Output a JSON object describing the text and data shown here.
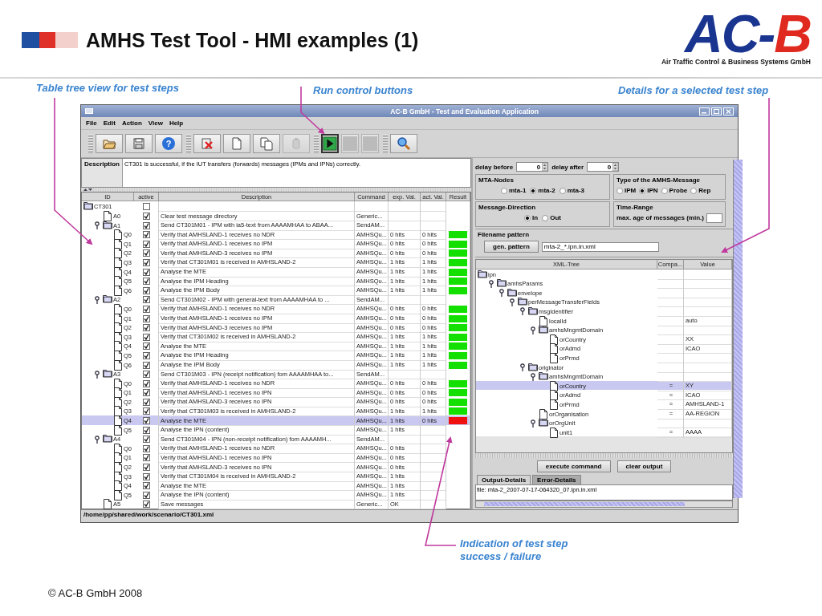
{
  "slide": {
    "title": "AMHS Test Tool - HMI examples (1)",
    "logo": {
      "text": "AC-",
      "accent": "B",
      "tagline": "Air Traffic Control & Business Systems GmbH"
    },
    "annotations": [
      {
        "text": "Table tree view for test steps"
      },
      {
        "text": "Run control buttons"
      },
      {
        "text": "Details for a selected test step"
      },
      {
        "text": "Indication of test step success / failure"
      }
    ],
    "footer": "© AC-B GmbH 2008"
  },
  "window": {
    "title": "AC-B GmbH - Test and Evaluation Application"
  },
  "menu": [
    "File",
    "Edit",
    "Action",
    "View",
    "Help"
  ],
  "toolbar": [
    {
      "buttons": [
        {
          "kind": "open",
          "disabled": false,
          "pressed": false
        },
        {
          "kind": "save",
          "disabled": false,
          "pressed": false
        },
        {
          "kind": "help",
          "glyph": "?",
          "disabled": false,
          "pressed": false
        }
      ]
    },
    {
      "buttons": [
        {
          "kind": "delete",
          "disabled": false,
          "pressed": false
        },
        {
          "kind": "new",
          "disabled": false,
          "pressed": false
        },
        {
          "kind": "copy",
          "disabled": false,
          "pressed": false
        },
        {
          "kind": "trash",
          "disabled": true,
          "pressed": false
        }
      ]
    },
    {
      "buttons": [
        {
          "kind": "play",
          "disabled": false,
          "pressed": true
        },
        {
          "kind": "pause",
          "disabled": true,
          "pressed": false
        },
        {
          "kind": "stop",
          "disabled": true,
          "pressed": false
        }
      ]
    },
    {
      "buttons": [
        {
          "kind": "search",
          "disabled": false,
          "pressed": false
        }
      ]
    }
  ],
  "description": {
    "label": "Description",
    "text": "CT301 is successful, if the IUT transfers (forwards) messages (IPMs and IPNs) correctly."
  },
  "test_table": {
    "columns": [
      "ID",
      "active",
      "Description",
      "Command",
      "exp. Val.",
      "act. Val.",
      "Result"
    ],
    "rows": [
      {
        "id": "CT301",
        "kind": "group",
        "active": false,
        "selected": false,
        "children": [
          {
            "id": "A0",
            "kind": "step",
            "active": true,
            "selected": false,
            "description": "Clear test message directory",
            "command": "Generic..."
          },
          {
            "id": "A1",
            "kind": "group",
            "expanded": true,
            "active": true,
            "selected": false,
            "description": "Send CT301M01 - IPM with ia5-text from AAAAMHAA to ABAA...",
            "command": "SendAM...",
            "children": [
              {
                "id": "Q0",
                "kind": "step",
                "active": true,
                "selected": false,
                "description": "Verify that AMHSLAND-1 receives no NDR",
                "command": "AMHSQu...",
                "expected": "0 hits",
                "actual": "0 hits",
                "passed": true
              },
              {
                "id": "Q1",
                "kind": "step",
                "active": true,
                "selected": false,
                "description": "Verify that AMHSLAND-1 receives no IPM",
                "command": "AMHSQu...",
                "expected": "0 hits",
                "actual": "0 hits",
                "passed": true
              },
              {
                "id": "Q2",
                "kind": "step",
                "active": true,
                "selected": false,
                "description": "Verify that AMHSLAND-3 receives no IPM",
                "command": "AMHSQu...",
                "expected": "0 hits",
                "actual": "0 hits",
                "passed": true
              },
              {
                "id": "Q3",
                "kind": "step",
                "active": true,
                "selected": false,
                "description": "Verify that CT301M01 is received in AMHSLAND-2",
                "command": "AMHSQu...",
                "expected": "1 hits",
                "actual": "1 hits",
                "passed": true
              },
              {
                "id": "Q4",
                "kind": "step",
                "active": true,
                "selected": false,
                "description": "Analyse the MTE",
                "command": "AMHSQu...",
                "expected": "1 hits",
                "actual": "1 hits",
                "passed": true
              },
              {
                "id": "Q5",
                "kind": "step",
                "active": true,
                "selected": false,
                "description": "Analyse the IPM Heading",
                "command": "AMHSQu...",
                "expected": "1 hits",
                "actual": "1 hits",
                "passed": true
              },
              {
                "id": "Q6",
                "kind": "step",
                "active": true,
                "selected": false,
                "description": "Analyse the IPM Body",
                "command": "AMHSQu...",
                "expected": "1 hits",
                "actual": "1 hits",
                "passed": true
              }
            ]
          },
          {
            "id": "A2",
            "kind": "group",
            "expanded": true,
            "active": true,
            "selected": false,
            "description": "Send CT301M02 - IPM with general-text from AAAAMHAA to ...",
            "command": "SendAM...",
            "children": [
              {
                "id": "Q0",
                "kind": "step",
                "active": true,
                "selected": false,
                "description": "Verify that AMHSLAND-1 receives no NDR",
                "command": "AMHSQu...",
                "expected": "0 hits",
                "actual": "0 hits",
                "passed": true
              },
              {
                "id": "Q1",
                "kind": "step",
                "active": true,
                "selected": false,
                "description": "Verify that AMHSLAND-1 receives no IPM",
                "command": "AMHSQu...",
                "expected": "0 hits",
                "actual": "0 hits",
                "passed": true
              },
              {
                "id": "Q2",
                "kind": "step",
                "active": true,
                "selected": false,
                "description": "Verify that AMHSLAND-3 receives no IPM",
                "command": "AMHSQu...",
                "expected": "0 hits",
                "actual": "0 hits",
                "passed": true
              },
              {
                "id": "Q3",
                "kind": "step",
                "active": true,
                "selected": false,
                "description": "Verify that CT301M02 is received in AMHSLAND-2",
                "command": "AMHSQu...",
                "expected": "1 hits",
                "actual": "1 hits",
                "passed": true
              },
              {
                "id": "Q4",
                "kind": "step",
                "active": true,
                "selected": false,
                "description": "Analyse the MTE",
                "command": "AMHSQu...",
                "expected": "1 hits",
                "actual": "1 hits",
                "passed": true
              },
              {
                "id": "Q5",
                "kind": "step",
                "active": true,
                "selected": false,
                "description": "Analyse the IPM Heading",
                "command": "AMHSQu...",
                "expected": "1 hits",
                "actual": "1 hits",
                "passed": true
              },
              {
                "id": "Q6",
                "kind": "step",
                "active": true,
                "selected": false,
                "description": "Analyse the IPM Body",
                "command": "AMHSQu...",
                "expected": "1 hits",
                "actual": "1 hits",
                "passed": true
              }
            ]
          },
          {
            "id": "A3",
            "kind": "group",
            "expanded": true,
            "active": true,
            "selected": false,
            "description": "Send CT301M03 - IPN (receipt notification) fom AAAAMHAA to...",
            "command": "SendAM...",
            "children": [
              {
                "id": "Q0",
                "kind": "step",
                "active": true,
                "selected": false,
                "description": "Verify that AMHSLAND-1 receives no NDR",
                "command": "AMHSQu...",
                "expected": "0 hits",
                "actual": "0 hits",
                "passed": true
              },
              {
                "id": "Q1",
                "kind": "step",
                "active": true,
                "selected": false,
                "description": "Verify that AMHSLAND-1 receives no IPN",
                "command": "AMHSQu...",
                "expected": "0 hits",
                "actual": "0 hits",
                "passed": true
              },
              {
                "id": "Q2",
                "kind": "step",
                "active": true,
                "selected": false,
                "description": "Verify that AMHSLAND-3 receives no IPN",
                "command": "AMHSQu...",
                "expected": "0 hits",
                "actual": "0 hits",
                "passed": true
              },
              {
                "id": "Q3",
                "kind": "step",
                "active": true,
                "selected": false,
                "description": "Verify that CT301M03 is received in AMHSLAND-2",
                "command": "AMHSQu...",
                "expected": "1 hits",
                "actual": "1 hits",
                "passed": true
              },
              {
                "id": "Q4",
                "kind": "step",
                "active": true,
                "selected": true,
                "description": "Analyse the MTE",
                "command": "AMHSQu...",
                "expected": "1 hits",
                "actual": "0 hits",
                "passed": false
              },
              {
                "id": "Q5",
                "kind": "step",
                "active": true,
                "selected": false,
                "description": "Analyse the IPN (content)",
                "command": "AMHSQu...",
                "expected": "1 hits"
              }
            ]
          },
          {
            "id": "A4",
            "kind": "group",
            "expanded": true,
            "active": true,
            "selected": false,
            "description": "Send CT301M04 - IPN (non-receipt notification) fom AAAAMH...",
            "command": "SendAM...",
            "children": [
              {
                "id": "Q0",
                "kind": "step",
                "active": true,
                "selected": false,
                "description": "Verify that AMHSLAND-1 receives no NDR",
                "command": "AMHSQu...",
                "expected": "0 hits"
              },
              {
                "id": "Q1",
                "kind": "step",
                "active": true,
                "selected": false,
                "description": "Verify that AMHSLAND-1 receives no IPN",
                "command": "AMHSQu...",
                "expected": "0 hits"
              },
              {
                "id": "Q2",
                "kind": "step",
                "active": true,
                "selected": false,
                "description": "Verify that AMHSLAND-3 receives no IPN",
                "command": "AMHSQu...",
                "expected": "0 hits"
              },
              {
                "id": "Q3",
                "kind": "step",
                "active": true,
                "selected": false,
                "description": "Verify that CT301M04 is received in AMHSLAND-2",
                "command": "AMHSQu...",
                "expected": "1 hits"
              },
              {
                "id": "Q4",
                "kind": "step",
                "active": true,
                "selected": false,
                "description": "Analyse the MTE",
                "command": "AMHSQu...",
                "expected": "1 hits"
              },
              {
                "id": "Q5",
                "kind": "step",
                "active": true,
                "selected": false,
                "description": "Analyse the IPN (content)",
                "command": "AMHSQu...",
                "expected": "1 hits"
              }
            ]
          },
          {
            "id": "A5",
            "kind": "step",
            "active": true,
            "selected": false,
            "description": "Save messages",
            "command": "Generic...",
            "expected": "OK"
          }
        ]
      }
    ]
  },
  "status_bar": "/home/pp/shared/work/scenario/CT301.xml",
  "details": {
    "delays": [
      {
        "label": "delay before",
        "value": "0"
      },
      {
        "label": "delay after",
        "value": "0"
      }
    ],
    "option_groups": [
      {
        "title": "MTA-Nodes",
        "options": [
          {
            "label": "mta-1",
            "selected": false
          },
          {
            "label": "mta-2",
            "selected": true
          },
          {
            "label": "mta-3",
            "selected": false
          }
        ]
      },
      {
        "title": "Type of the AMHS-Message",
        "options": [
          {
            "label": "IPM",
            "selected": false
          },
          {
            "label": "IPN",
            "selected": true
          },
          {
            "label": "Probe",
            "selected": false
          },
          {
            "label": "Rep",
            "selected": false
          }
        ]
      },
      {
        "title": "Message-Direction",
        "options": [
          {
            "label": "In",
            "selected": true
          },
          {
            "label": "Out",
            "selected": false
          }
        ]
      }
    ],
    "time_range": {
      "title": "Time-Range",
      "label": "max. age of messages (min.)"
    },
    "filename_pattern": {
      "title": "Filename pattern",
      "button": "gen. pattern",
      "value": "mta-2_*.ipn.in.xml"
    },
    "xml_table": {
      "columns": [
        "XML-Tree",
        "Compa...",
        "Value"
      ],
      "rows": [
        {
          "name": "ipn",
          "kind": "element",
          "selected": false,
          "children": [
            {
              "name": "amhsParams",
              "kind": "element",
              "expanded": true,
              "selected": false,
              "children": [
                {
                  "name": "envelope",
                  "kind": "element",
                  "expanded": true,
                  "selected": false,
                  "children": [
                    {
                      "name": "perMessageTransferFields",
                      "kind": "element",
                      "expanded": true,
                      "selected": false,
                      "children": [
                        {
                          "name": "msgIdentifier",
                          "kind": "element",
                          "expanded": true,
                          "selected": false,
                          "children": [
                            {
                              "name": "localId",
                              "kind": "field",
                              "selected": false,
                              "value": "auto"
                            },
                            {
                              "name": "amhsMngmtDomain",
                              "kind": "element",
                              "expanded": true,
                              "selected": false,
                              "children": [
                                {
                                  "name": "orCountry",
                                  "kind": "field",
                                  "selected": false,
                                  "value": "XX"
                                },
                                {
                                  "name": "orAdmd",
                                  "kind": "field",
                                  "selected": false,
                                  "value": "ICAO"
                                },
                                {
                                  "name": "orPrmd",
                                  "kind": "field",
                                  "selected": false
                                }
                              ]
                            }
                          ]
                        },
                        {
                          "name": "originator",
                          "kind": "element",
                          "expanded": true,
                          "selected": false,
                          "children": [
                            {
                              "name": "amhsMngmtDomain",
                              "kind": "element",
                              "expanded": true,
                              "selected": false,
                              "children": [
                                {
                                  "name": "orCountry",
                                  "kind": "field",
                                  "selected": true,
                                  "compare": "=",
                                  "value": "XY"
                                },
                                {
                                  "name": "orAdmd",
                                  "kind": "field",
                                  "selected": false,
                                  "compare": "=",
                                  "value": "ICAO"
                                },
                                {
                                  "name": "orPrmd",
                                  "kind": "field",
                                  "selected": false,
                                  "compare": "=",
                                  "value": "AMHSLAND-1"
                                }
                              ]
                            },
                            {
                              "name": "orOrganisation",
                              "kind": "field",
                              "selected": false,
                              "compare": "=",
                              "value": "AA-REGION"
                            },
                            {
                              "name": "orOrgUnit",
                              "kind": "element",
                              "expanded": true,
                              "selected": false,
                              "children": [
                                {
                                  "name": "unit1",
                                  "kind": "field",
                                  "selected": false,
                                  "compare": "=",
                                  "value": "AAAA"
                                }
                              ]
                            }
                          ]
                        }
                      ]
                    }
                  ]
                }
              ]
            }
          ]
        }
      ]
    },
    "buttons": [
      "execute command",
      "clear output"
    ],
    "output_tabs": [
      {
        "label": "Output-Details",
        "selected": true
      },
      {
        "label": "Error-Details",
        "selected": false
      }
    ],
    "output": "file: mta-2_2007-07-17-064320_07.ipn.in.xml"
  }
}
